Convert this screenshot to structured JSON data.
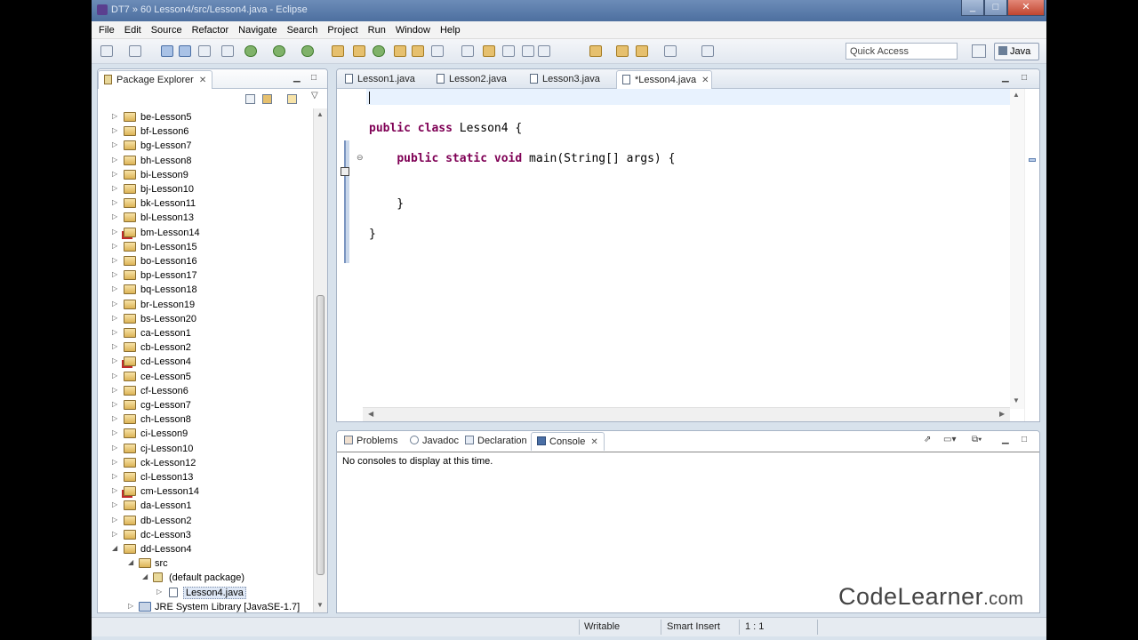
{
  "window": {
    "title": "DT7 » 60 Lesson4/src/Lesson4.java - Eclipse"
  },
  "menu": [
    "File",
    "Edit",
    "Source",
    "Refactor",
    "Navigate",
    "Search",
    "Project",
    "Run",
    "Window",
    "Help"
  ],
  "toolbar": {
    "quick_access_placeholder": "Quick Access",
    "perspective": "Java"
  },
  "package_explorer": {
    "title": "Package Explorer",
    "projects": [
      "be-Lesson5",
      "bf-Lesson6",
      "bg-Lesson7",
      "bh-Lesson8",
      "bi-Lesson9",
      "bj-Lesson10",
      "bk-Lesson11",
      "bl-Lesson13",
      "bm-Lesson14",
      "bn-Lesson15",
      "bo-Lesson16",
      "bp-Lesson17",
      "bq-Lesson18",
      "br-Lesson19",
      "bs-Lesson20",
      "ca-Lesson1",
      "cb-Lesson2",
      "cd-Lesson4",
      "ce-Lesson5",
      "cf-Lesson6",
      "cg-Lesson7",
      "ch-Lesson8",
      "ci-Lesson9",
      "cj-Lesson10",
      "ck-Lesson12",
      "cl-Lesson13",
      "cm-Lesson14",
      "da-Lesson1",
      "db-Lesson2",
      "dc-Lesson3",
      "dd-Lesson4"
    ],
    "expanded": {
      "src": "src",
      "package": "(default package)",
      "file": "Lesson4.java",
      "library": "JRE System Library [JavaSE-1.7]"
    }
  },
  "editor": {
    "tabs": [
      "Lesson1.java",
      "Lesson2.java",
      "Lesson3.java",
      "*Lesson4.java"
    ],
    "code": [
      "",
      "",
      "public class Lesson4 {",
      "",
      "    public static void main(String[] args) {",
      "",
      "",
      "    }",
      "",
      "}"
    ]
  },
  "bottom_panel": {
    "tabs": [
      "Problems",
      "Javadoc",
      "Declaration",
      "Console"
    ],
    "console_message": "No consoles to display at this time."
  },
  "status": {
    "mode": "Writable",
    "insert": "Smart Insert",
    "position": "1 : 1"
  },
  "watermark": {
    "brand": "CodeLearner",
    "domain": ".com"
  },
  "colors": {
    "keyword": "#7f0055",
    "current_line": "#e8f2fe"
  },
  "icons": [
    "package-explorer-icon",
    "java-file-icon",
    "console-icon",
    "folder-icon",
    "package-icon",
    "library-icon"
  ]
}
